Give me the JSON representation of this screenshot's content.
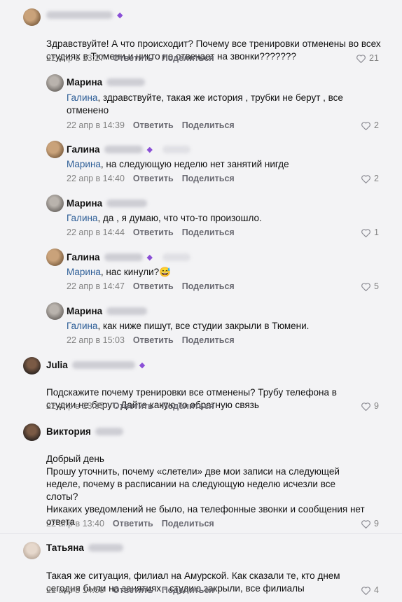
{
  "comments": [
    {
      "author": "",
      "text_parts": [
        {
          "t": "Здравствуйте! А что происходит? Почему все тренировки отменены во всех студиях в Тюмени и никто не отвечает на звонки???????",
          "m": false
        }
      ],
      "date": "22 апр в 13:27",
      "reply": "Ответить",
      "share": "Поделиться",
      "likes": "21"
    },
    {
      "author": "Марина",
      "text_parts": [
        {
          "t": "Галина",
          "m": true
        },
        {
          "t": ", здравствуйте, такая же история , трубки не берут , все отменено",
          "m": false
        }
      ],
      "date": "22 апр в 14:39",
      "reply": "Ответить",
      "share": "Поделиться",
      "likes": "2"
    },
    {
      "author": "Галина",
      "text_parts": [
        {
          "t": "Марина",
          "m": true
        },
        {
          "t": ", на следующую неделю нет занятий нигде",
          "m": false
        }
      ],
      "date": "22 апр в 14:40",
      "reply": "Ответить",
      "share": "Поделиться",
      "likes": "2"
    },
    {
      "author": "Марина",
      "text_parts": [
        {
          "t": "Галина",
          "m": true
        },
        {
          "t": ", да , я думаю, что что-то произошло.",
          "m": false
        }
      ],
      "date": "22 апр в 14:44",
      "reply": "Ответить",
      "share": "Поделиться",
      "likes": "1"
    },
    {
      "author": "Галина",
      "text_parts": [
        {
          "t": "Марина",
          "m": true
        },
        {
          "t": ", нас кинули?😅",
          "m": false
        }
      ],
      "date": "22 апр в 14:47",
      "reply": "Ответить",
      "share": "Поделиться",
      "likes": "5"
    },
    {
      "author": "Марина",
      "text_parts": [
        {
          "t": "Галина",
          "m": true
        },
        {
          "t": ", как ниже пишут, все студии закрыли в Тюмени.",
          "m": false
        }
      ],
      "date": "22 апр в 15:03",
      "reply": "Ответить",
      "share": "Поделиться",
      "likes": ""
    },
    {
      "author": "Julia",
      "text_parts": [
        {
          "t": "Подскажите почему тренировки все отменены? Трубу телефона в студии не берут. Дайте какую то обратную связь",
          "m": false
        }
      ],
      "date": "22 апр в 13:35",
      "reply": "Ответить",
      "share": "Поделиться",
      "likes": "9"
    },
    {
      "author": "Виктория",
      "text_parts": [
        {
          "t": "Добрый день\nПрошу уточнить, почему «слетели» две мои записи на следующей неделе, почему в расписании на следующую неделю исчезли все слоты?\nНикаких уведомлений не было, на телефонные звонки и сообщения нет ответа",
          "m": false
        }
      ],
      "date": "22 апр в 13:40",
      "reply": "Ответить",
      "share": "Поделиться",
      "likes": "9"
    },
    {
      "author": "Татьяна",
      "text_parts": [
        {
          "t": "Такая же ситуация, филиал на Амурской. Как сказали те, кто днем сегодня были на занятиях - студию закрыли, все филиалы",
          "m": false
        }
      ],
      "date": "22 апр в 14:58",
      "reply": "Ответить",
      "share": "Поделиться",
      "likes": "4"
    }
  ]
}
